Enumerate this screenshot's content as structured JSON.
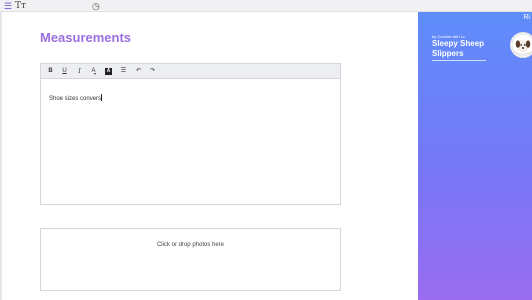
{
  "topbar": {
    "icons": [
      "layers-icon",
      "text-format-icon",
      "history-clock-icon"
    ],
    "text_icon_glyph": "Tт",
    "layers_glyph": "☰",
    "clock_glyph": "◷"
  },
  "main": {
    "title": "Measurements",
    "editor": {
      "toolbar": {
        "bold": "B",
        "underline": "U",
        "italic": "I",
        "font_color": "A",
        "highlight": "A",
        "list": "☰",
        "undo": "↶",
        "redo": "↷"
      },
      "content": "Shoe sizes convers"
    },
    "dropzone": {
      "label": "Click or drop photos here"
    }
  },
  "preview": {
    "tag": "Ri",
    "byline": "by Crochet with Lx",
    "title": "Sleepy Sheep Slippers"
  },
  "colors": {
    "accent": "#9b6fe0",
    "preview_gradient_top": "#5e8dfa",
    "preview_gradient_bottom": "#9a6cf0"
  }
}
